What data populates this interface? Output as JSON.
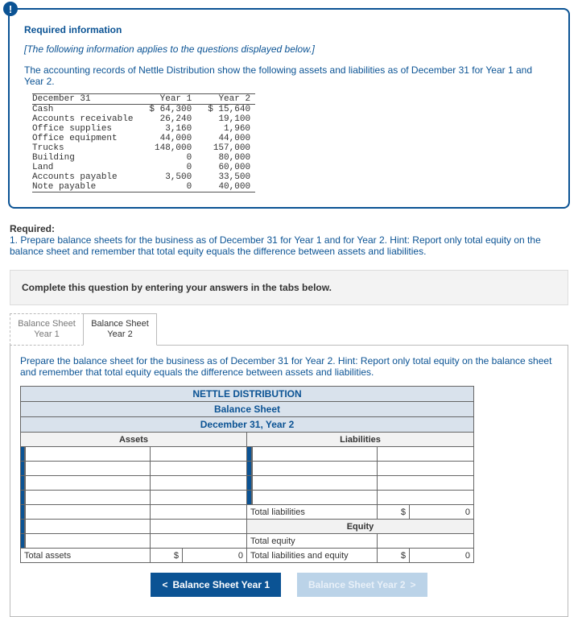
{
  "info": {
    "title": "Required information",
    "subtitle": "[The following information applies to the questions displayed below.]",
    "body": "The accounting records of Nettle Distribution show the following assets and liabilities as of December 31 for Year 1 and Year 2."
  },
  "given": {
    "hdr_date": "December 31",
    "hdr_y1": "Year 1",
    "hdr_y2": "Year 2",
    "rows": [
      {
        "label": "Cash",
        "y1": "$ 64,300",
        "y2": "$ 15,640"
      },
      {
        "label": "Accounts receivable",
        "y1": "26,240",
        "y2": "19,100"
      },
      {
        "label": "Office supplies",
        "y1": "3,160",
        "y2": "1,960"
      },
      {
        "label": "Office equipment",
        "y1": "44,000",
        "y2": "44,000"
      },
      {
        "label": "Trucks",
        "y1": "148,000",
        "y2": "157,000"
      },
      {
        "label": "Building",
        "y1": "0",
        "y2": "80,000"
      },
      {
        "label": "Land",
        "y1": "0",
        "y2": "60,000"
      },
      {
        "label": "Accounts payable",
        "y1": "3,500",
        "y2": "33,500"
      },
      {
        "label": "Note payable",
        "y1": "0",
        "y2": "40,000"
      }
    ]
  },
  "required": {
    "heading": "Required:",
    "text": "1. Prepare balance sheets for the business as of December 31 for Year 1 and for Year 2. Hint: Report only total equity on the balance sheet and remember that total equity equals the difference between assets and liabilities."
  },
  "complete_prompt": "Complete this question by entering your answers in the tabs below.",
  "tabs": {
    "t1_line1": "Balance Sheet",
    "t1_line2": "Year 1",
    "t2_line1": "Balance Sheet",
    "t2_line2": "Year 2"
  },
  "panel_text": "Prepare the balance sheet for the business as of December 31 for Year 2. Hint: Report only total equity on the balance sheet and remember that total equity equals the difference between assets and liabilities.",
  "sheet": {
    "company": "NETTLE DISTRIBUTION",
    "title": "Balance Sheet",
    "date": "December 31, Year 2",
    "assets_hdr": "Assets",
    "liab_hdr": "Liabilities",
    "total_liab": "Total liabilities",
    "equity_hdr": "Equity",
    "total_equity": "Total equity",
    "total_liab_eq": "Total liabilities and equity",
    "total_assets": "Total assets",
    "dollar": "$",
    "zero": "0"
  },
  "nav": {
    "prev_arrow": "<",
    "prev": "Balance Sheet Year 1",
    "next": "Balance Sheet Year 2",
    "next_arrow": ">"
  }
}
